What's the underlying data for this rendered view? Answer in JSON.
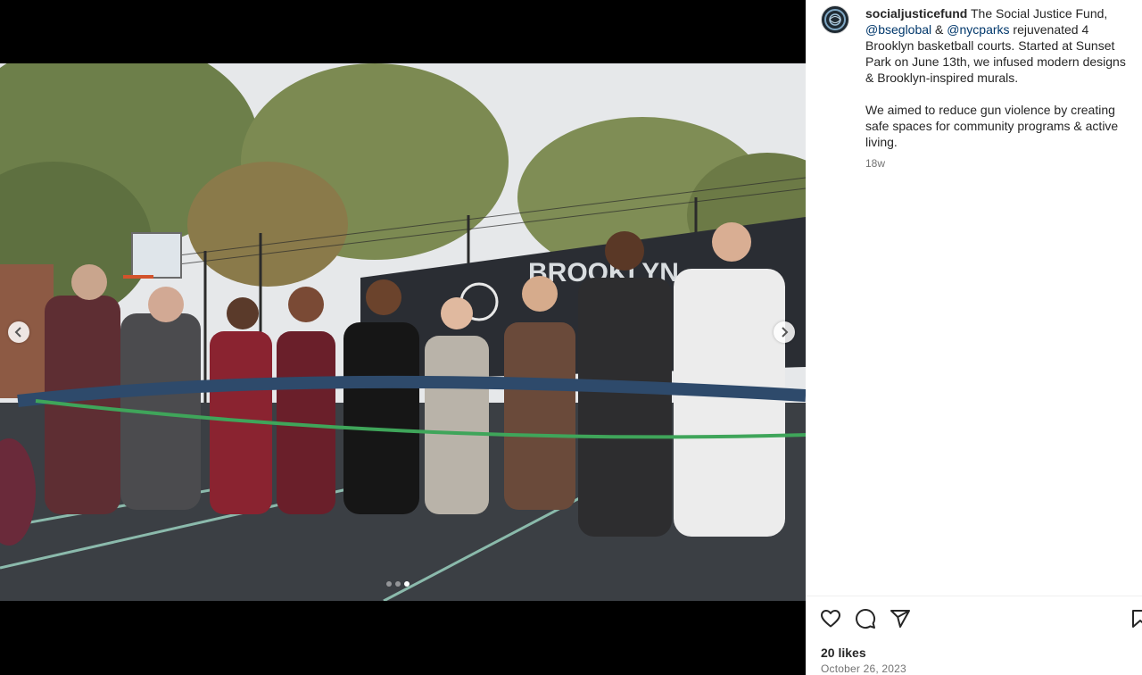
{
  "post": {
    "username": "socialjusticefund",
    "caption_parts": {
      "intro": " The Social Justice Fund, ",
      "mention1": "@bseglobal",
      "and": " & ",
      "mention2": "@nycparks",
      "rest": " rejuvenated 4 Brooklyn basketball courts. Started at Sunset Park on June 13th, we infused modern designs & Brooklyn-inspired murals."
    },
    "caption_paragraph2": "We aimed to reduce gun violence by creating safe spaces for community programs & active living.",
    "time_ago": "18w",
    "likes": "20 likes",
    "date": "October 26, 2023"
  },
  "carousel": {
    "slide_count": 3,
    "active_index": 2
  },
  "photo": {
    "banner_text": "BROOKLYN",
    "colors": {
      "court": "#3b3f44",
      "ribbon_blue": "#2e4a6b",
      "ribbon_green": "#3fa55a",
      "sky": "#e6e8ea",
      "banner": "#2a2d33"
    }
  },
  "icons": {
    "avatar": "brand-logo-icon",
    "like": "heart-icon",
    "comment": "comment-icon",
    "share": "paper-plane-icon",
    "save": "bookmark-icon",
    "prev": "chevron-left-icon",
    "next": "chevron-right-icon"
  }
}
